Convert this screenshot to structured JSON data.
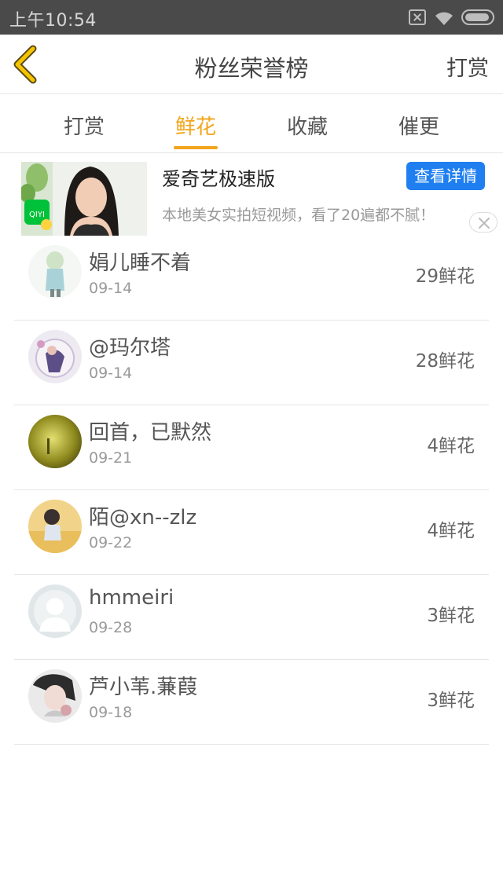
{
  "status_bar": {
    "time": "上午10:54"
  },
  "header": {
    "title": "粉丝荣誉榜",
    "right_action": "打赏"
  },
  "tabs": [
    {
      "label": "打赏",
      "active": false
    },
    {
      "label": "鲜花",
      "active": true
    },
    {
      "label": "收藏",
      "active": false
    },
    {
      "label": "催更",
      "active": false
    }
  ],
  "ad": {
    "title": "爱奇艺极速版",
    "button": "查看详情",
    "description": "本地美女实拍短视频，看了20遍都不腻！",
    "logo_text": "QIYI"
  },
  "fans": [
    {
      "name": "娟儿睡不着",
      "date": "09-14",
      "count": "29鲜花"
    },
    {
      "name": "@玛尔塔",
      "date": "09-14",
      "count": "28鲜花"
    },
    {
      "name": "回首，已默然",
      "date": "09-21",
      "count": "4鲜花"
    },
    {
      "name": "陌@xn--zlz",
      "date": "09-22",
      "count": "4鲜花"
    },
    {
      "name": "hmmeiri",
      "date": "09-28",
      "count": "3鲜花"
    },
    {
      "name": "芦小苇.蒹葭",
      "date": "09-18",
      "count": "3鲜花"
    }
  ],
  "colors": {
    "accent": "#f2a51a",
    "status_bar": "#4a4a4a",
    "ad_button": "#1f7ff0"
  }
}
